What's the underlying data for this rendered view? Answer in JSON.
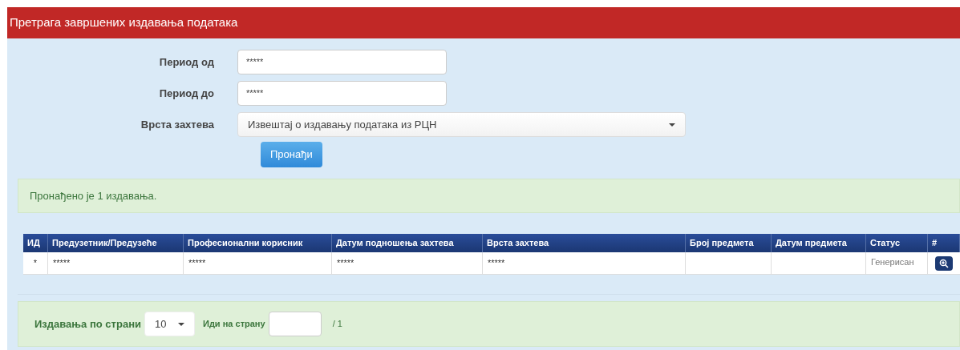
{
  "header": {
    "title": "Претрага завршених издавања података"
  },
  "form": {
    "fields": [
      {
        "label": "Период од",
        "value": "*****"
      },
      {
        "label": "Период до",
        "value": "*****"
      }
    ],
    "select": {
      "label": "Врста захтева",
      "value": "Извештај о издавању података из РЦН"
    },
    "button": "Пронађи"
  },
  "alert": "Пронађено је 1 издавања.",
  "table": {
    "columns": [
      "ИД",
      "Предузетник/Предузеће",
      "Професионални корисник",
      "Датум подношења захтева",
      "Врста захтева",
      "Број предмета",
      "Датум предмета",
      "Статус",
      "#"
    ],
    "rows": [
      {
        "cells": [
          "*",
          "*****",
          "*****",
          "*****",
          "*****",
          "",
          "",
          "Генерисан"
        ]
      }
    ]
  },
  "pagination": {
    "per_page_label": "Издавања по страни",
    "per_page": "10",
    "goto_label": "Иди на страну",
    "total": "/ 1"
  }
}
